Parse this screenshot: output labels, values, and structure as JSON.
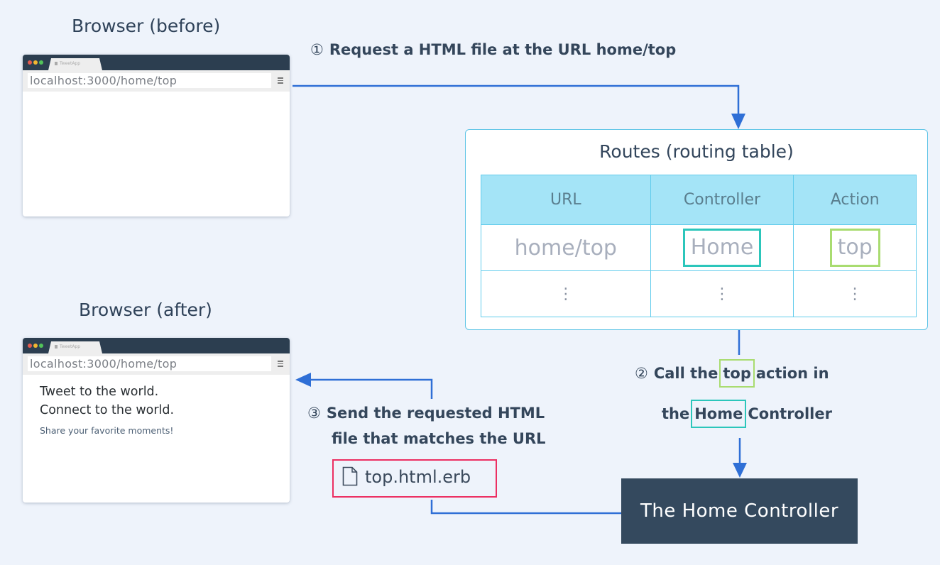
{
  "colors": {
    "background": "#eef3fb",
    "arrow": "#2f6fd6",
    "titlebar": "#2c3e50",
    "routes_border": "#5ec4e6",
    "routes_header": "#a4e4f7",
    "highlight_controller": "#2cc6bb",
    "highlight_action": "#a9dc70",
    "highlight_file": "#ec2f62",
    "controller_box": "#34495e",
    "traffic_lights": [
      "#e45b4f",
      "#f2b631",
      "#52c35a"
    ]
  },
  "browser_before": {
    "title": "Browser (before)",
    "tab_label": "TweetApp",
    "url": "localhost:3000/home/top",
    "menu_icon": "hamburger-menu-icon"
  },
  "browser_after": {
    "title": "Browser (after)",
    "tab_label": "TweetApp",
    "url": "localhost:3000/home/top",
    "menu_icon": "hamburger-menu-icon",
    "content": {
      "line1": "Tweet to the world.",
      "line2": "Connect to the world.",
      "subtitle": "Share your favorite moments!"
    }
  },
  "steps": {
    "step1": {
      "number": "①",
      "text": "Request a HTML file at the URL home/top"
    },
    "step2": {
      "number": "②",
      "line1_prefix": "Call the",
      "line1_highlight": "top",
      "line1_suffix": "action in",
      "line2_prefix": "the",
      "line2_highlight": "Home",
      "line2_suffix": "Controller"
    },
    "step3": {
      "number": "③",
      "line1": "Send the requested HTML",
      "line2": "file that matches the URL"
    }
  },
  "routes": {
    "title": "Routes (routing table)",
    "columns": [
      "URL",
      "Controller",
      "Action"
    ],
    "rows": [
      [
        "home/top",
        "Home",
        "top"
      ],
      [
        "⋮",
        "⋮",
        "⋮"
      ]
    ]
  },
  "file": {
    "icon": "file-icon",
    "name": "top.html.erb"
  },
  "controller": {
    "label": "The Home Controller"
  }
}
